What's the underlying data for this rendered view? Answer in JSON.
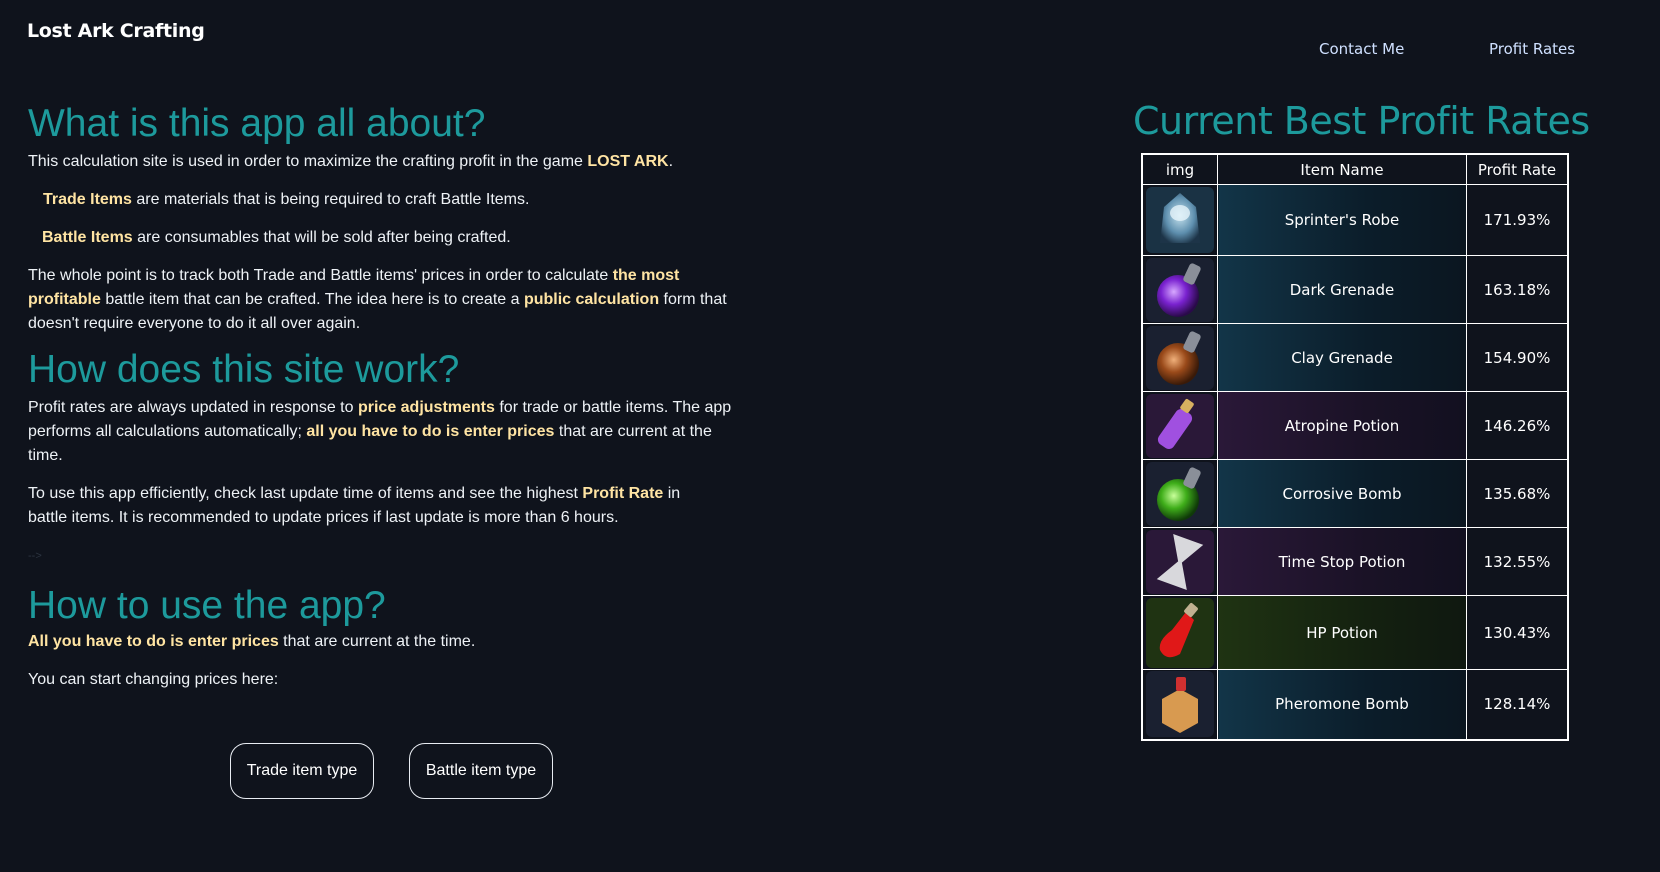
{
  "header": {
    "brand": "Lost Ark Crafting",
    "nav": [
      {
        "label": "Contact Me"
      },
      {
        "label": "Profit Rates"
      }
    ]
  },
  "intro": {
    "title": "What is this app all about?",
    "p1_pre": "This calculation site is used in order to maximize the crafting profit in the game ",
    "p1_hl": "LOST ARK",
    "p1_post": ".",
    "p2_hl": "Trade Items",
    "p2_post": " are materials that is being required to craft Battle Items.",
    "p3_hl": "Battle Items",
    "p3_post": " are consumables that will be sold after being crafted.",
    "p4_a": "The whole point is to track both Trade and Battle items' prices in order to calculate ",
    "p4_hl1": "the most profitable",
    "p4_b": " battle item that can be crafted. The idea here is to create a ",
    "p4_hl2": "public calculation",
    "p4_c": " form that doesn't require everyone to do it all over again."
  },
  "how": {
    "title": "How does this site work?",
    "p1_a": "Profit rates are always updated in response to ",
    "p1_hl1": "price adjustments",
    "p1_b": " for trade or battle items. The app performs all calculations automatically; ",
    "p1_hl2": "all you have to do is enter prices",
    "p1_c": " that are current at the time.",
    "p2_a": "To use this app efficiently, check last update time of items and see the highest ",
    "p2_hl": "Profit Rate",
    "p2_b": " in battle items. It is recommended to update prices if last update is more than 6 hours.",
    "stray": "-->"
  },
  "usage": {
    "title": "How to use the app?",
    "p1_hl": "All you have to do is enter prices",
    "p1_post": " that are current at the time.",
    "p2": "You can start changing prices here:",
    "buttons": {
      "trade": "Trade item type",
      "battle": "Battle item type"
    }
  },
  "rates": {
    "title": "Current Best Profit Rates",
    "columns": [
      "img",
      "Item Name",
      "Profit Rate"
    ],
    "rows": [
      {
        "name": "Sprinter's Robe",
        "rate": "171.93%",
        "icon": "robe-icon",
        "tone": "blue"
      },
      {
        "name": "Dark Grenade",
        "rate": "163.18%",
        "icon": "dark-grenade-icon",
        "tone": "blue"
      },
      {
        "name": "Clay Grenade",
        "rate": "154.90%",
        "icon": "clay-grenade-icon",
        "tone": "blue"
      },
      {
        "name": "Atropine Potion",
        "rate": "146.26%",
        "icon": "atropine-potion-icon",
        "tone": "purple"
      },
      {
        "name": "Corrosive Bomb",
        "rate": "135.68%",
        "icon": "corrosive-bomb-icon",
        "tone": "blue"
      },
      {
        "name": "Time Stop Potion",
        "rate": "132.55%",
        "icon": "hourglass-icon",
        "tone": "purple"
      },
      {
        "name": "HP Potion",
        "rate": "130.43%",
        "icon": "hp-potion-icon",
        "tone": "green"
      },
      {
        "name": "Pheromone Bomb",
        "rate": "128.14%",
        "icon": "pheromone-bomb-icon",
        "tone": "blue"
      }
    ]
  },
  "colors": {
    "background": "#0f131c",
    "heading": "#1d9a9c",
    "highlight": "#ffe4a3",
    "nav": "#cfe0ff"
  }
}
